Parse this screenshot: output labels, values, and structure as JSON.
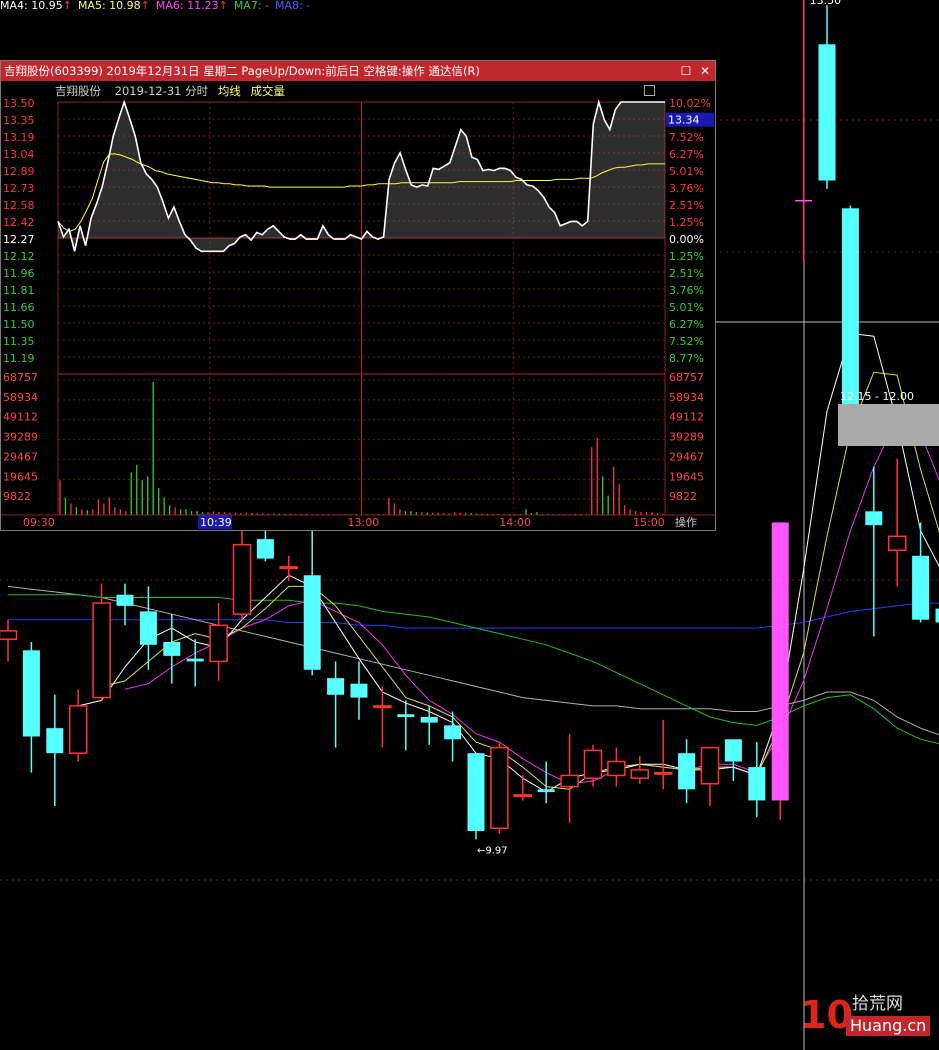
{
  "ma_legend": [
    {
      "label": "MA4: 10.95",
      "arrow": "↑",
      "color": "#ffffff"
    },
    {
      "label": "MA5: 10.98",
      "arrow": "↑",
      "color": "#ffff66"
    },
    {
      "label": "MA6: 11.23",
      "arrow": "↑",
      "color": "#ff44ff"
    },
    {
      "label": "MA7: -",
      "arrow": "",
      "color": "#33cc33"
    },
    {
      "label": "MA8: -",
      "arrow": "",
      "color": "#3366ff"
    }
  ],
  "kline": {
    "price_range": [
      9.6,
      13.6
    ],
    "high_label": "13.50",
    "low_label": "←9.97",
    "range_label": "12.15 - 12.00",
    "up_color": "#ff3333",
    "down_color": "#55ffff",
    "limit_up_color": "#ff55ff",
    "candles": [
      {
        "o": 11.2,
        "h": 11.27,
        "l": 11.12,
        "c": 11.23
      },
      {
        "o": 11.16,
        "h": 11.19,
        "l": 10.72,
        "c": 10.85
      },
      {
        "o": 10.88,
        "h": 11.0,
        "l": 10.6,
        "c": 10.79
      },
      {
        "o": 10.79,
        "h": 11.02,
        "l": 10.76,
        "c": 10.96
      },
      {
        "o": 10.99,
        "h": 11.4,
        "l": 10.98,
        "c": 11.33
      },
      {
        "o": 11.36,
        "h": 11.4,
        "l": 11.25,
        "c": 11.32
      },
      {
        "o": 11.3,
        "h": 11.39,
        "l": 11.09,
        "c": 11.18
      },
      {
        "o": 11.19,
        "h": 11.29,
        "l": 11.04,
        "c": 11.14
      },
      {
        "o": 11.13,
        "h": 11.2,
        "l": 11.03,
        "c": 11.12
      },
      {
        "o": 11.12,
        "h": 11.33,
        "l": 11.05,
        "c": 11.25
      },
      {
        "o": 11.29,
        "h": 11.61,
        "l": 11.27,
        "c": 11.54
      },
      {
        "o": 11.56,
        "h": 11.68,
        "l": 11.48,
        "c": 11.49
      },
      {
        "o": 11.46,
        "h": 11.5,
        "l": 11.41,
        "c": 11.46
      },
      {
        "o": 11.43,
        "h": 11.6,
        "l": 11.07,
        "c": 11.09
      },
      {
        "o": 11.06,
        "h": 11.12,
        "l": 10.81,
        "c": 11.0
      },
      {
        "o": 11.04,
        "h": 11.12,
        "l": 10.91,
        "c": 10.99
      },
      {
        "o": 10.96,
        "h": 11.03,
        "l": 10.81,
        "c": 10.96
      },
      {
        "o": 10.93,
        "h": 10.98,
        "l": 10.8,
        "c": 10.92
      },
      {
        "o": 10.92,
        "h": 10.96,
        "l": 10.82,
        "c": 10.9
      },
      {
        "o": 10.89,
        "h": 10.94,
        "l": 10.76,
        "c": 10.84
      },
      {
        "o": 10.79,
        "h": 10.79,
        "l": 10.48,
        "c": 10.51
      },
      {
        "o": 10.52,
        "h": 10.83,
        "l": 10.5,
        "c": 10.81
      },
      {
        "o": 10.64,
        "h": 10.71,
        "l": 10.62,
        "c": 10.64
      },
      {
        "o": 10.66,
        "h": 10.76,
        "l": 10.61,
        "c": 10.65
      },
      {
        "o": 10.67,
        "h": 10.86,
        "l": 10.54,
        "c": 10.71
      },
      {
        "o": 10.7,
        "h": 10.82,
        "l": 10.67,
        "c": 10.8
      },
      {
        "o": 10.71,
        "h": 10.81,
        "l": 10.67,
        "c": 10.76
      },
      {
        "o": 10.7,
        "h": 10.78,
        "l": 10.68,
        "c": 10.73
      },
      {
        "o": 10.72,
        "h": 10.91,
        "l": 10.66,
        "c": 10.72
      },
      {
        "o": 10.79,
        "h": 10.84,
        "l": 10.61,
        "c": 10.66
      },
      {
        "o": 10.68,
        "h": 10.77,
        "l": 10.6,
        "c": 10.81
      },
      {
        "o": 10.84,
        "h": 10.83,
        "l": 10.69,
        "c": 10.76
      },
      {
        "o": 10.74,
        "h": 10.83,
        "l": 10.56,
        "c": 10.62
      },
      {
        "o": 10.62,
        "h": 11.62,
        "l": 10.55,
        "c": 11.62
      },
      {
        "o": 12.78,
        "h": 13.5,
        "l": 12.56,
        "c": 12.78
      },
      {
        "o": 13.34,
        "h": 13.48,
        "l": 12.82,
        "c": 12.85
      },
      {
        "o": 12.75,
        "h": 12.76,
        "l": 11.91,
        "c": 11.92
      },
      {
        "o": 11.66,
        "h": 11.82,
        "l": 11.21,
        "c": 11.61
      },
      {
        "o": 11.52,
        "h": 11.85,
        "l": 11.39,
        "c": 11.57
      },
      {
        "o": 11.5,
        "h": 11.62,
        "l": 11.26,
        "c": 11.27
      },
      {
        "o": 11.31,
        "h": 11.35,
        "l": 11.15,
        "c": 11.26
      }
    ],
    "ma4": [
      null,
      null,
      null,
      10.96,
      10.98,
      11.1,
      11.2,
      11.24,
      11.19,
      11.17,
      11.27,
      11.35,
      11.43,
      11.39,
      11.26,
      11.13,
      11.01,
      10.97,
      10.94,
      10.9,
      10.79,
      10.77,
      10.7,
      10.65,
      10.7,
      10.72,
      10.73,
      10.75,
      10.75,
      10.73,
      10.73,
      10.74,
      10.71,
      10.95,
      11.45,
      12.02,
      12.3,
      12.29,
      11.98,
      11.59,
      11.43
    ],
    "ma5": [
      null,
      null,
      null,
      null,
      11.03,
      11.05,
      11.12,
      11.19,
      11.22,
      11.2,
      11.24,
      11.31,
      11.39,
      11.39,
      11.32,
      11.21,
      11.1,
      10.99,
      10.96,
      10.92,
      10.83,
      10.8,
      10.74,
      10.67,
      10.66,
      10.72,
      10.74,
      10.75,
      10.74,
      10.73,
      10.74,
      10.74,
      10.71,
      10.89,
      11.15,
      11.57,
      11.95,
      12.16,
      12.15,
      11.81,
      11.53
    ],
    "ma6": [
      null,
      null,
      null,
      null,
      null,
      11.02,
      11.04,
      11.1,
      11.15,
      11.19,
      11.24,
      11.27,
      11.32,
      11.34,
      11.3,
      11.26,
      11.18,
      11.07,
      10.98,
      10.93,
      10.86,
      10.83,
      10.77,
      10.72,
      10.68,
      10.69,
      10.73,
      10.75,
      10.74,
      10.73,
      10.75,
      10.75,
      10.72,
      10.86,
      11.05,
      11.31,
      11.59,
      11.82,
      11.99,
      11.94,
      11.73
    ],
    "ma_green": [
      11.36,
      11.36,
      11.36,
      11.36,
      11.35,
      11.35,
      11.35,
      11.35,
      11.35,
      11.35,
      11.34,
      11.34,
      11.34,
      11.33,
      11.33,
      11.32,
      11.3,
      11.29,
      11.28,
      11.26,
      11.24,
      11.22,
      11.2,
      11.18,
      11.15,
      11.12,
      11.08,
      11.04,
      11.0,
      10.96,
      10.92,
      10.9,
      10.89,
      10.92,
      10.96,
      10.99,
      11.0,
      10.95,
      10.88,
      10.84,
      10.82
    ],
    "ma_blue": [
      11.27,
      11.27,
      11.27,
      11.27,
      11.27,
      11.27,
      11.27,
      11.27,
      11.27,
      11.27,
      11.27,
      11.27,
      11.26,
      11.26,
      11.26,
      11.25,
      11.25,
      11.24,
      11.24,
      11.24,
      11.24,
      11.24,
      11.24,
      11.24,
      11.24,
      11.24,
      11.24,
      11.24,
      11.24,
      11.24,
      11.24,
      11.24,
      11.24,
      11.25,
      11.26,
      11.28,
      11.3,
      11.31,
      11.32,
      11.33,
      11.33
    ],
    "ma_gray": [
      11.39,
      11.38,
      11.37,
      11.36,
      11.35,
      11.33,
      11.31,
      11.29,
      11.27,
      11.25,
      11.23,
      11.21,
      11.19,
      11.17,
      11.15,
      11.13,
      11.11,
      11.09,
      11.07,
      11.05,
      11.03,
      11.01,
      10.99,
      10.98,
      10.97,
      10.96,
      10.96,
      10.95,
      10.95,
      10.95,
      10.95,
      10.94,
      10.94,
      10.96,
      10.98,
      11.01,
      11.01,
      10.98,
      10.92,
      10.88,
      10.85
    ]
  },
  "popup": {
    "title": "吉翔股份(603399) 2019年12月31日 星期二 PageUp/Down:前后日 空格键:操作 通达信(R)",
    "btn_max": "☐",
    "btn_close": "✕",
    "stock_name": "吉翔股份",
    "date_label": "2019-12-31 分时",
    "avg_label": "均线",
    "vol_label": "成交量",
    "prev_close": 12.27,
    "price_min": 11.12,
    "price_max": 13.5,
    "price_ticks": [
      "13.50",
      "13.35",
      "13.19",
      "13.04",
      "12.89",
      "12.73",
      "12.58",
      "12.42",
      "12.27",
      "12.12",
      "11.96",
      "11.81",
      "11.66",
      "11.50",
      "11.35",
      "11.19"
    ],
    "pct_ticks": [
      "10.02%",
      "8.77%",
      "7.52%",
      "6.27%",
      "5.01%",
      "3.76%",
      "2.51%",
      "1.25%",
      "0.00%",
      "1.25%",
      "2.51%",
      "3.76%",
      "5.01%",
      "6.27%",
      "7.52%",
      "8.77%"
    ],
    "vol_ticks": [
      "68757",
      "58934",
      "49112",
      "39289",
      "29467",
      "19645",
      "9822"
    ],
    "vol_max": 68757,
    "current_price": "13.34",
    "time_labels": [
      "09:30",
      "10:3",
      "13:00",
      "14:00",
      "15:00"
    ],
    "cursor_time": "10:39",
    "action_label": "操作",
    "price_colors": {
      "up": "#ff3333",
      "down": "#33cc33",
      "flat": "#ffffff"
    },
    "price_series": [
      12.42,
      12.28,
      12.35,
      12.15,
      12.38,
      12.2,
      12.45,
      12.58,
      12.73,
      12.95,
      13.19,
      13.35,
      13.5,
      13.35,
      13.19,
      12.95,
      12.85,
      12.8,
      12.73,
      12.6,
      12.45,
      12.55,
      12.42,
      12.3,
      12.25,
      12.18,
      12.15,
      12.15,
      12.15,
      12.15,
      12.15,
      12.2,
      12.22,
      12.28,
      12.3,
      12.25,
      12.32,
      12.3,
      12.35,
      12.38,
      12.33,
      12.28,
      12.26,
      12.26,
      12.3,
      12.26,
      12.26,
      12.26,
      12.38,
      12.3,
      12.26,
      12.26,
      12.26,
      12.3,
      12.28,
      12.26,
      12.33,
      12.28,
      12.26,
      12.28,
      12.8,
      12.95,
      13.04,
      12.89,
      12.75,
      12.73,
      12.75,
      12.74,
      12.9,
      12.89,
      12.92,
      12.95,
      13.1,
      13.25,
      13.19,
      13.0,
      12.98,
      12.88,
      12.89,
      12.88,
      12.9,
      12.9,
      12.88,
      12.82,
      12.8,
      12.75,
      12.74,
      12.7,
      12.64,
      12.55,
      12.5,
      12.38,
      12.4,
      12.42,
      12.42,
      12.38,
      12.42,
      13.3,
      13.5,
      13.34,
      13.25,
      13.43,
      13.5,
      13.5,
      13.5,
      13.5,
      13.5,
      13.5,
      13.5,
      13.5,
      13.5
    ],
    "avg_series": [
      12.42,
      12.36,
      12.33,
      12.35,
      12.42,
      12.52,
      12.63,
      12.8,
      12.96,
      13.03,
      13.03,
      13.02,
      13.0,
      12.98,
      12.95,
      12.93,
      12.91,
      12.88,
      12.87,
      12.85,
      12.84,
      12.83,
      12.82,
      12.81,
      12.8,
      12.79,
      12.78,
      12.77,
      12.77,
      12.76,
      12.76,
      12.75,
      12.75,
      12.74,
      12.74,
      12.74,
      12.74,
      12.73,
      12.73,
      12.73,
      12.73,
      12.73,
      12.73,
      12.73,
      12.73,
      12.73,
      12.73,
      12.73,
      12.73,
      12.73,
      12.73,
      12.74,
      12.74,
      12.74,
      12.75,
      12.75,
      12.76,
      12.76,
      12.76,
      12.76,
      12.77,
      12.77,
      12.77,
      12.77,
      12.77,
      12.77,
      12.77,
      12.77,
      12.77,
      12.77,
      12.78,
      12.78,
      12.78,
      12.78,
      12.78,
      12.78,
      12.78,
      12.78,
      12.78,
      12.78,
      12.79,
      12.79,
      12.79,
      12.79,
      12.79,
      12.79,
      12.79,
      12.8,
      12.8,
      12.8,
      12.8,
      12.81,
      12.81,
      12.81,
      12.83,
      12.86,
      12.88,
      12.9,
      12.91,
      12.91,
      12.92,
      12.93,
      12.93,
      12.94,
      12.94,
      12.94,
      12.94
    ],
    "volume_series": [
      18000,
      9000,
      6000,
      4000,
      3000,
      2500,
      3000,
      8000,
      6000,
      9000,
      4000,
      3000,
      2000,
      22000,
      26000,
      18000,
      20000,
      68757,
      14000,
      9000,
      5000,
      4000,
      3000,
      3000,
      2000,
      2000,
      1500,
      1500,
      1800,
      1600,
      1500,
      1200,
      1000,
      1000,
      1200,
      1000,
      900,
      800,
      800,
      900,
      700,
      600,
      600,
      500,
      700,
      600,
      500,
      500,
      500,
      400,
      400,
      400,
      500,
      600,
      500,
      400,
      400,
      400,
      400,
      500,
      9000,
      6000,
      3000,
      2000,
      2000,
      1500,
      1500,
      1200,
      1200,
      1000,
      1000,
      900,
      1500,
      1200,
      1000,
      900,
      800,
      700,
      700,
      600,
      600,
      600,
      600,
      500,
      500,
      3000,
      1000,
      1500,
      600,
      600,
      500,
      500,
      500,
      500,
      600,
      500,
      500,
      35000,
      40000,
      20000,
      10000,
      25000,
      16000,
      5000,
      3000,
      2000,
      1500,
      1500,
      1500,
      1000,
      800
    ]
  },
  "watermark": {
    "num": "10",
    "cn": "拾荒网",
    "en": "Huang.cn"
  }
}
